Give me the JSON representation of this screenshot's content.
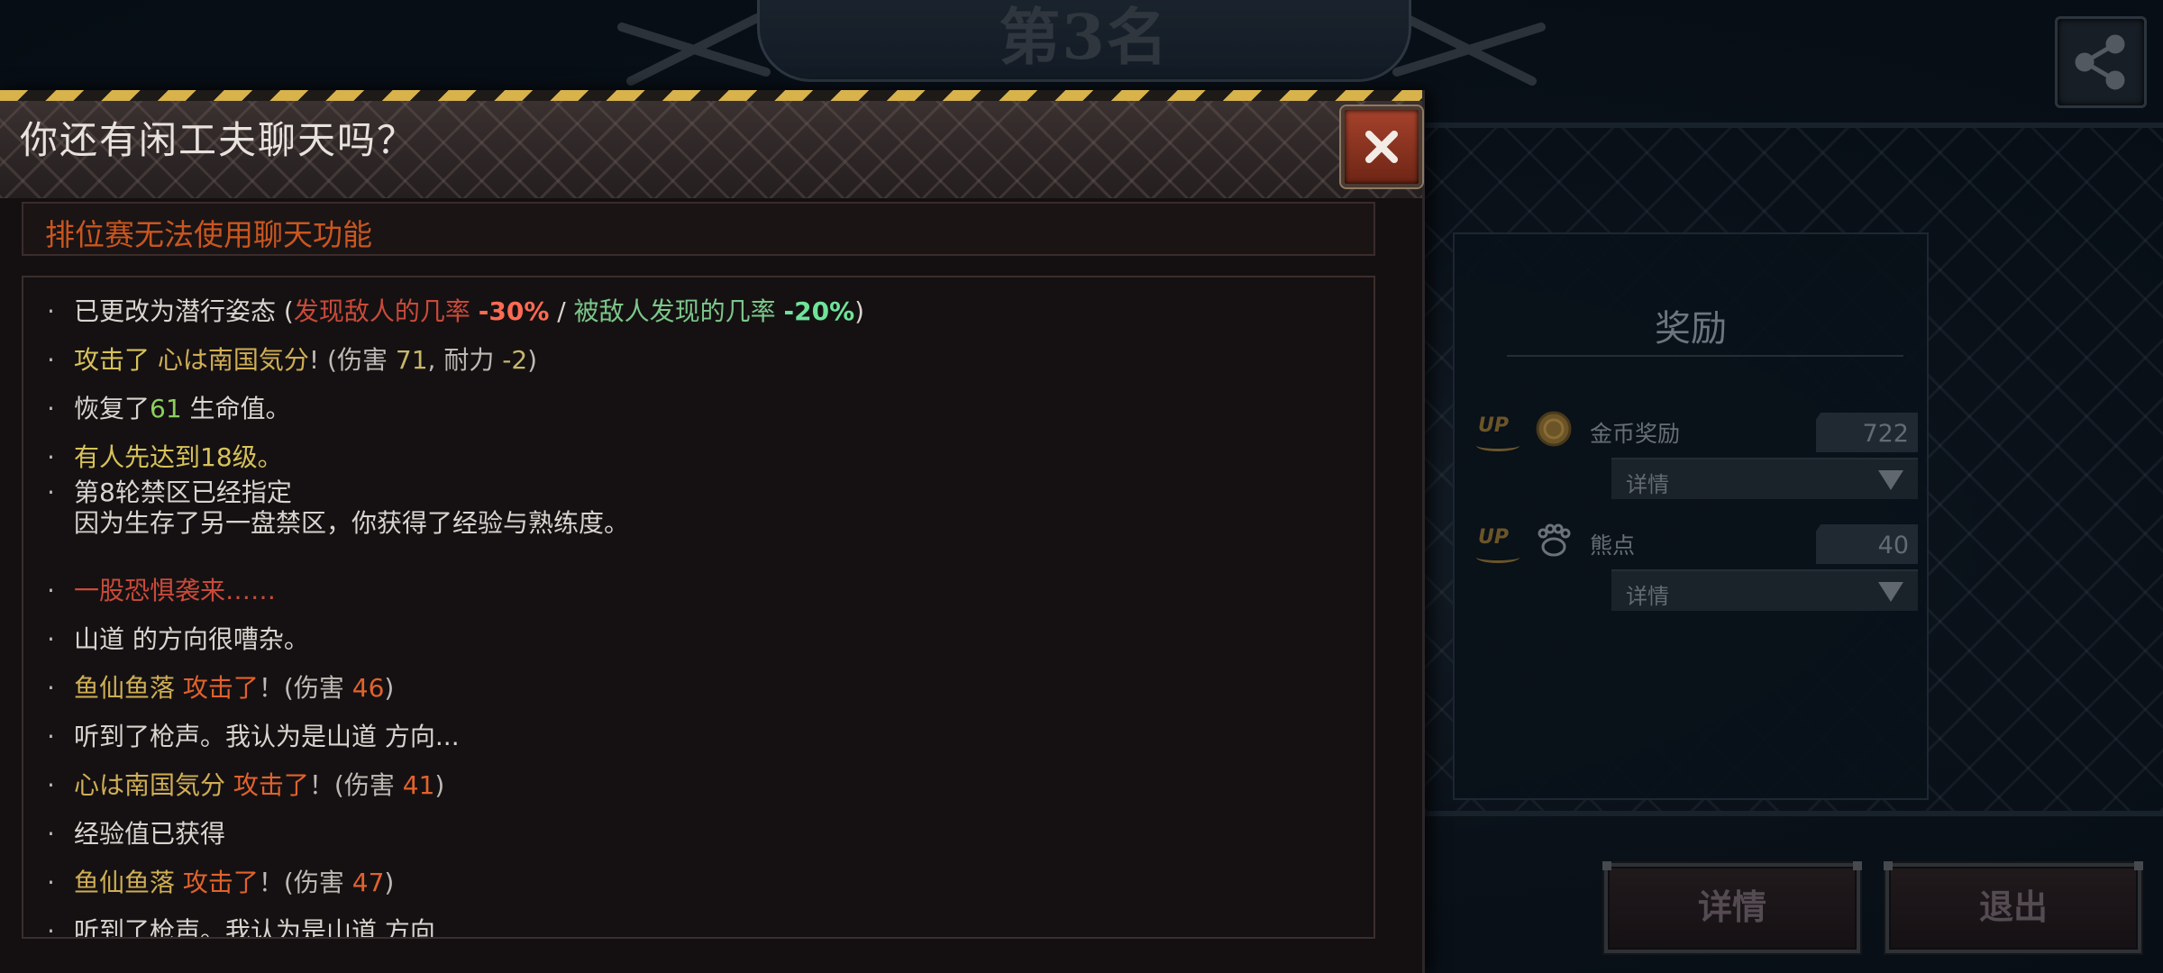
{
  "background": {
    "rank_title": "第3名",
    "reward_panel": {
      "title": "奖励",
      "rows": [
        {
          "badge": "UP",
          "icon": "gold-coin-icon",
          "label": "金币奖励",
          "value": "722",
          "dropdown": "详情"
        },
        {
          "badge": "UP",
          "icon": "bear-paw-icon",
          "label": "熊点",
          "value": "40",
          "dropdown": "详情"
        }
      ]
    },
    "buttons": {
      "details": "详情",
      "exit": "退出"
    }
  },
  "dialog": {
    "title": "你还有闲工夫聊天吗？",
    "notice": "排位赛无法使用聊天功能",
    "log": [
      {
        "segments": [
          {
            "t": "已更改为潜行姿态 (",
            "c": "c-white"
          },
          {
            "t": "发现敌人的几率 ",
            "c": "c-red"
          },
          {
            "t": "-30%",
            "c": "c-redb"
          },
          {
            "t": " / ",
            "c": "c-white"
          },
          {
            "t": "被敌人发现的几率 ",
            "c": "c-green"
          },
          {
            "t": "-20%",
            "c": "c-greenb"
          },
          {
            "t": ")",
            "c": "c-white"
          }
        ]
      },
      {
        "segments": [
          {
            "t": "攻击了 ",
            "c": "c-yellow"
          },
          {
            "t": "心は南国気分",
            "c": "c-gold"
          },
          {
            "t": "! (伤害 ",
            "c": "c-gray"
          },
          {
            "t": "71",
            "c": "c-num-y"
          },
          {
            "t": ",  耐力  ",
            "c": "c-gray"
          },
          {
            "t": "-2",
            "c": "c-num-y"
          },
          {
            "t": ")",
            "c": "c-gray"
          }
        ]
      },
      {
        "segments": [
          {
            "t": "恢复了",
            "c": "c-white"
          },
          {
            "t": "61",
            "c": "c-num-g"
          },
          {
            "t": " 生命值。",
            "c": "c-white"
          }
        ]
      },
      {
        "segments": [
          {
            "t": "有人先达到18级。",
            "c": "c-yellow"
          }
        ]
      },
      {
        "segments": [
          {
            "t": "第8轮禁区已经指定",
            "c": "c-white"
          }
        ],
        "line2": "因为生存了另一盘禁区，你获得了经验与熟练度。"
      },
      {
        "segments": [
          {
            "t": "一股恐惧袭来……",
            "c": "c-red"
          }
        ]
      },
      {
        "segments": [
          {
            "t": "山道 的方向很嘈杂。",
            "c": "c-white"
          }
        ]
      },
      {
        "segments": [
          {
            "t": "鱼仙鱼落  ",
            "c": "c-gold"
          },
          {
            "t": "攻击了",
            "c": "c-orange"
          },
          {
            "t": "！(伤害 ",
            "c": "c-gray"
          },
          {
            "t": "46",
            "c": "c-num-o"
          },
          {
            "t": ")",
            "c": "c-gray"
          }
        ]
      },
      {
        "segments": [
          {
            "t": "听到了枪声。我认为是山道 方向...",
            "c": "c-white"
          }
        ]
      },
      {
        "segments": [
          {
            "t": "心は南国気分  ",
            "c": "c-gold"
          },
          {
            "t": "攻击了",
            "c": "c-orange"
          },
          {
            "t": "！(伤害 ",
            "c": "c-gray"
          },
          {
            "t": "41",
            "c": "c-num-o"
          },
          {
            "t": ")",
            "c": "c-gray"
          }
        ]
      },
      {
        "segments": [
          {
            "t": "经验值已获得",
            "c": "c-white"
          }
        ]
      },
      {
        "segments": [
          {
            "t": "鱼仙鱼落  ",
            "c": "c-gold"
          },
          {
            "t": "攻击了",
            "c": "c-orange"
          },
          {
            "t": "！(伤害 ",
            "c": "c-gray"
          },
          {
            "t": "47",
            "c": "c-num-o"
          },
          {
            "t": ")",
            "c": "c-gray"
          }
        ]
      },
      {
        "segments": [
          {
            "t": "听到了枪声。我认为是山道 方向",
            "c": "c-white"
          }
        ]
      }
    ]
  },
  "colors": {
    "hazard_yellow": "#d8b24a",
    "notice_orange": "#c9561f",
    "close_red": "#a5422c"
  }
}
